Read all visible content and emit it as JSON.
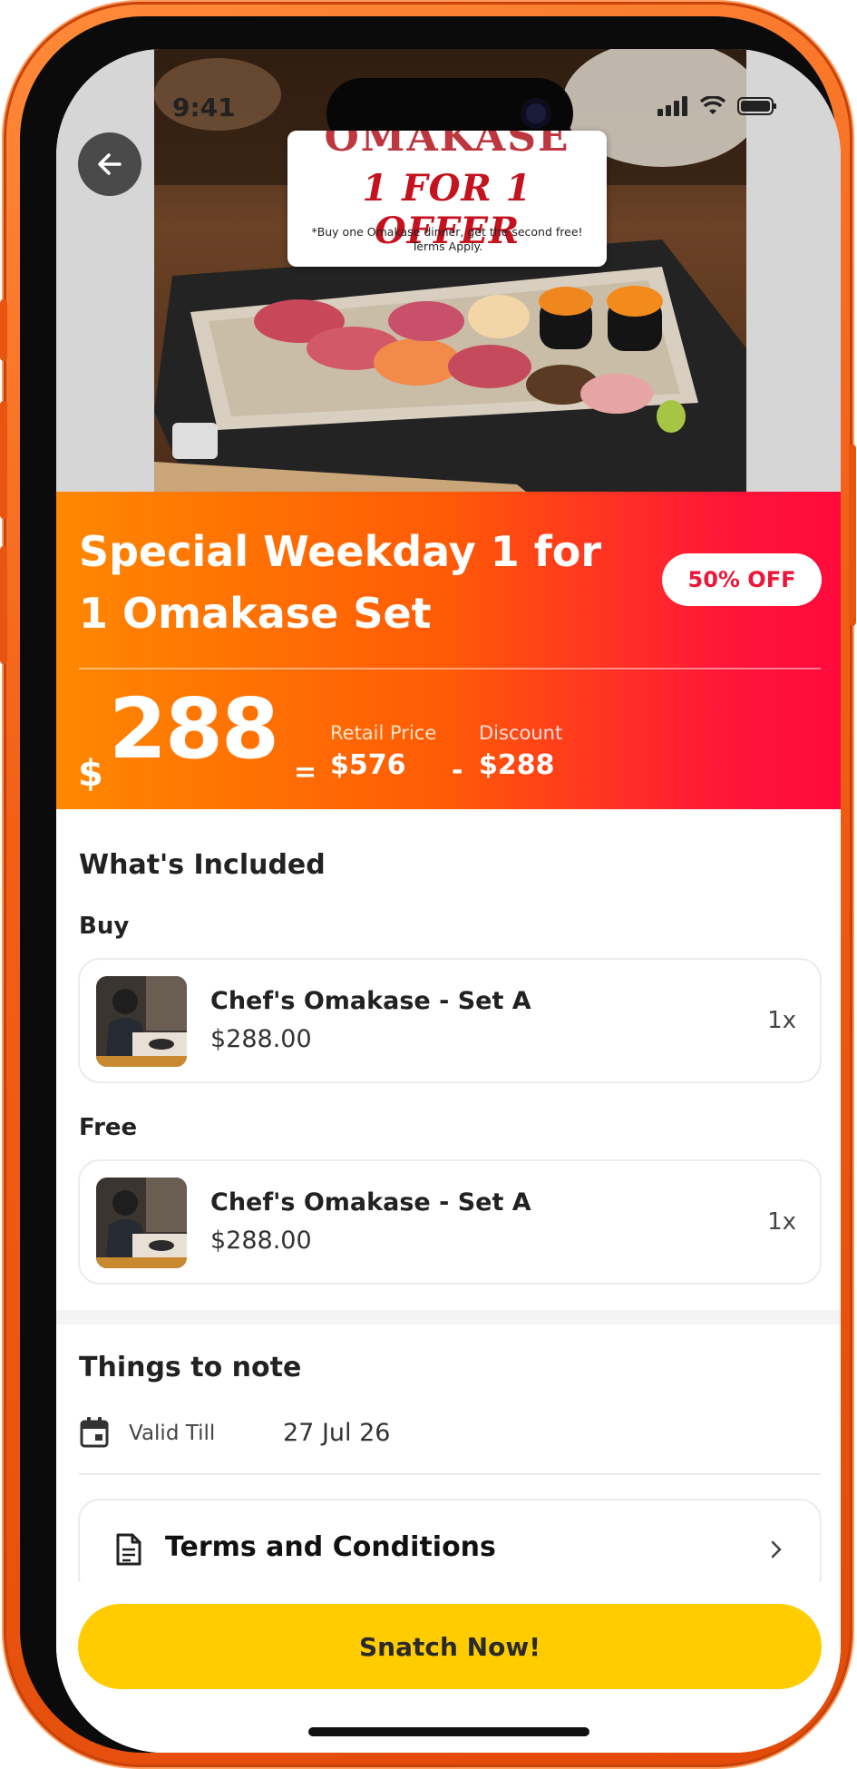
{
  "status_bar": {
    "time": "9:41"
  },
  "hero": {
    "brand_text": "OMAKASE",
    "offer_text": "1 FOR 1 OFFER",
    "terms_text": "*Buy one Omakase dinner, get the second free! Terms Apply."
  },
  "deal": {
    "title": "Special Weekday 1 for 1 Omakase Set",
    "discount_badge": "50% OFF",
    "currency": "$",
    "price": "288",
    "equals": "=",
    "minus": "-",
    "retail_label": "Retail Price",
    "retail_value": "$576",
    "discount_label": "Discount",
    "discount_value": "$288"
  },
  "included": {
    "heading": "What's Included",
    "buy": {
      "label": "Buy",
      "item": {
        "name": "Chef's Omakase - Set A",
        "price": "$288.00",
        "qty": "1x"
      }
    },
    "free": {
      "label": "Free",
      "item": {
        "name": "Chef's Omakase - Set A",
        "price": "$288.00",
        "qty": "1x"
      }
    }
  },
  "notes": {
    "heading": "Things to note",
    "valid_label": "Valid Till",
    "valid_value": "27 Jul 26",
    "terms_label": "Terms and Conditions"
  },
  "cta": {
    "label": "Snatch Now!"
  },
  "colors": {
    "frame": "#f26016",
    "gradient_start": "#ff8800",
    "gradient_end": "#ff0a3c",
    "badge_text": "#ee1638",
    "cta": "#ffcc00"
  },
  "icons": {
    "back": "arrow-left-icon",
    "calendar": "calendar-icon",
    "document": "document-icon",
    "chevron": "chevron-right-icon"
  }
}
